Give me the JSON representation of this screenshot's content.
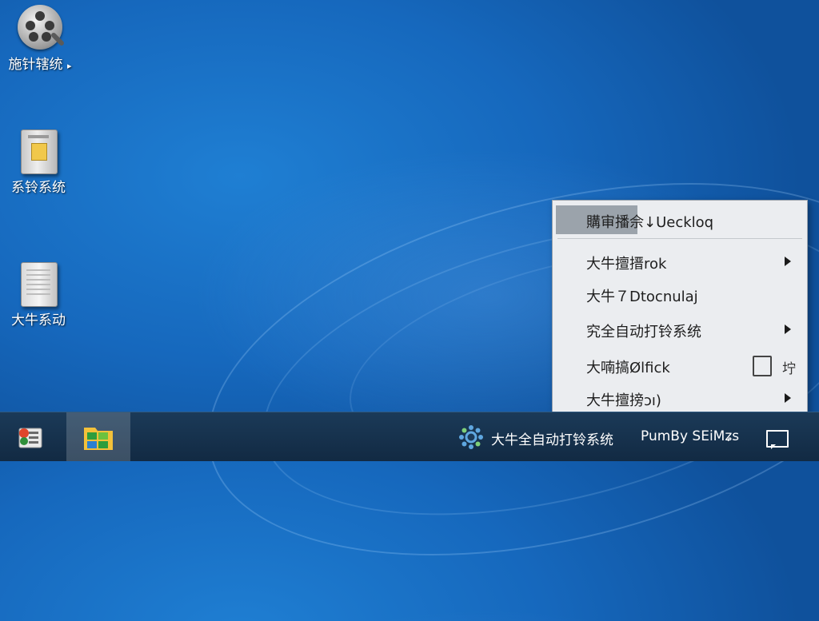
{
  "desktop": {
    "icons": [
      {
        "label": "施针辖统",
        "icon": "film-reel-magnifier-icon"
      },
      {
        "label": "系铃系统",
        "icon": "cabinet-icon"
      },
      {
        "label": "大牛系动",
        "icon": "server-box-icon"
      }
    ],
    "first_icon_marker": "▸"
  },
  "context_menu": {
    "items": [
      {
        "label": "購审播佘↓Ueckloq",
        "has_submenu": false
      },
      {
        "label": "大牛擅搢rok",
        "has_submenu": true
      },
      {
        "label": "大牛７Dtocnulaj",
        "has_submenu": false
      },
      {
        "label": "究全自动打铃系统",
        "has_submenu": true
      },
      {
        "label": "大喃搞Ølfick",
        "has_submenu": false,
        "shortcut": "坾"
      },
      {
        "label": "大牛擅搒ɔı)",
        "has_submenu": true
      }
    ]
  },
  "taskbar": {
    "app_title": "大牛全自动打铃系统",
    "tray_text": "PumBy SEiMʑs"
  },
  "colors": {
    "desktop_blue": "#1668bd",
    "taskbar": "#122a43",
    "menu_bg": "#ebedf0"
  }
}
